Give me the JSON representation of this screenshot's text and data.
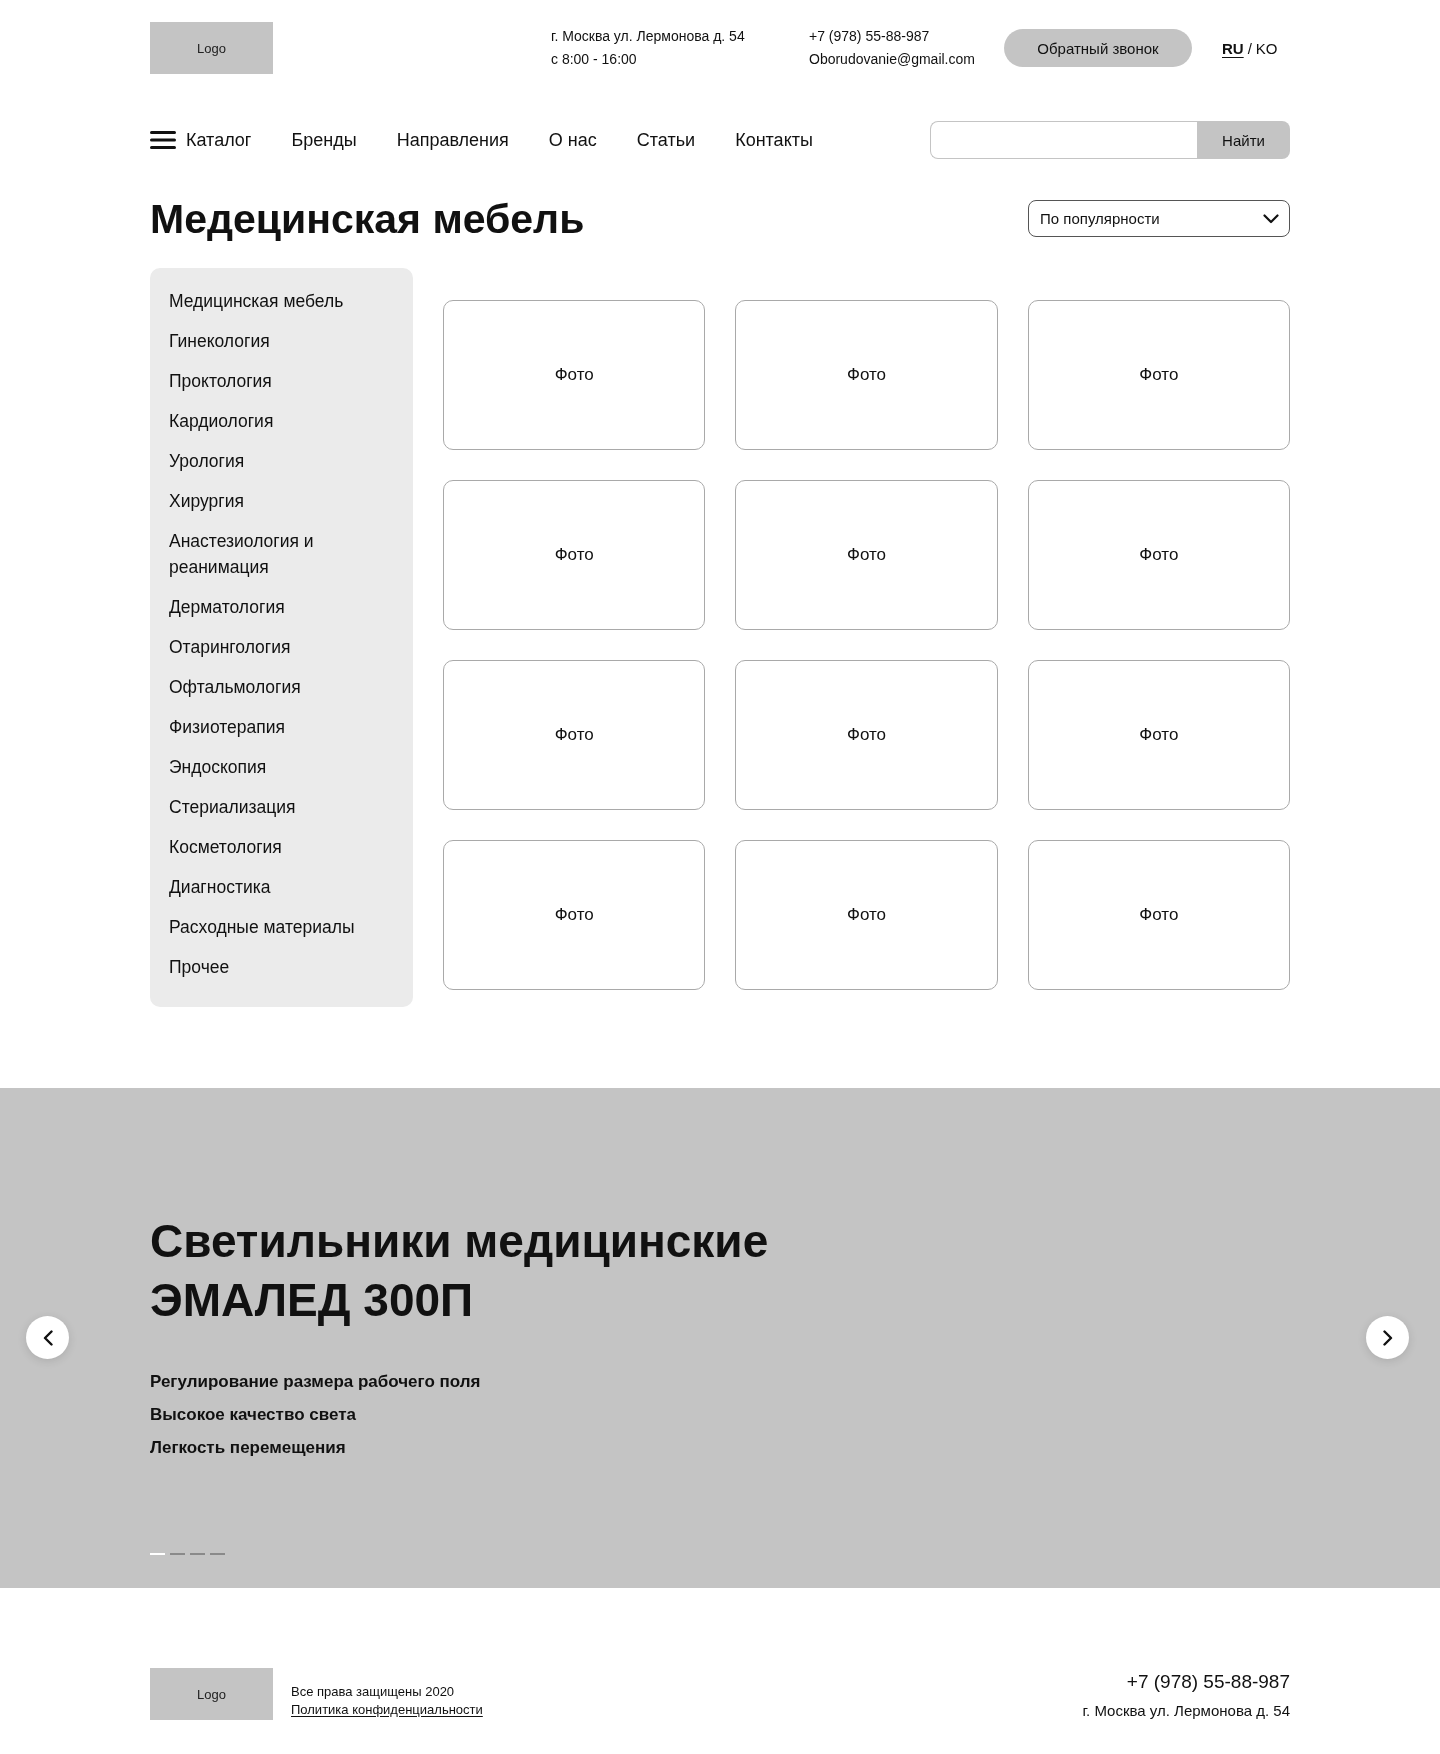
{
  "header": {
    "logo": "Logo",
    "address": "г. Москва ул. Лермонова д. 54",
    "hours": "с 8:00 - 16:00",
    "phone": "+7 (978) 55-88-987",
    "email": "Oborudovanie@gmail.com",
    "callback_button": "Обратный звонок",
    "languages": [
      {
        "label": "RU",
        "selected": true
      },
      {
        "label": "KO",
        "selected": false
      }
    ],
    "language_separator": "/"
  },
  "nav": {
    "items": [
      {
        "label": "Каталог",
        "kind": "menu"
      },
      {
        "label": "Бренды",
        "kind": "link"
      },
      {
        "label": "Направления",
        "kind": "link"
      },
      {
        "label": "О нас",
        "kind": "link"
      },
      {
        "label": "Статьи",
        "kind": "link"
      },
      {
        "label": "Контакты",
        "kind": "link"
      }
    ],
    "search": {
      "button": "Найти"
    }
  },
  "page": {
    "title": "Медецинская мебель",
    "sort": {
      "value": "По популярности"
    }
  },
  "sidebar": {
    "items": [
      "Медицинская мебель",
      "Гинекология",
      "Проктология",
      "Кардиология",
      "Урология",
      "Хирургия",
      "Анастезиология и реанимация",
      "Дерматология",
      "Отарингология",
      "Офтальмология",
      "Физиотерапия",
      "Эндоскопия",
      "Стериализация",
      "Косметология",
      "Диагностика",
      "Расходные материалы",
      "Прочее"
    ]
  },
  "products": [
    {
      "photo": "Фото"
    },
    {
      "photo": "Фото"
    },
    {
      "photo": "Фото"
    },
    {
      "photo": "Фото"
    },
    {
      "photo": "Фото"
    },
    {
      "photo": "Фото"
    },
    {
      "photo": "Фото"
    },
    {
      "photo": "Фото"
    },
    {
      "photo": "Фото"
    },
    {
      "photo": "Фото"
    },
    {
      "photo": "Фото"
    },
    {
      "photo": "Фото"
    }
  ],
  "banner": {
    "title_lines": [
      "Светильники медицинские",
      "ЭМАЛЕД 300П"
    ],
    "features": [
      "Регулирование размера рабочего поля",
      "Высокое качество света",
      "Легкость перемещения"
    ],
    "slides": [
      {
        "selected": true
      },
      {
        "selected": false
      },
      {
        "selected": false
      },
      {
        "selected": false
      }
    ]
  },
  "footer": {
    "logo": "Logo",
    "copyright": "Все права защищены 2020",
    "privacy_link": "Политика конфиденциальности",
    "phone": "+7 (978) 55-88-987",
    "address": "г. Москва ул. Лермонова д. 54"
  }
}
